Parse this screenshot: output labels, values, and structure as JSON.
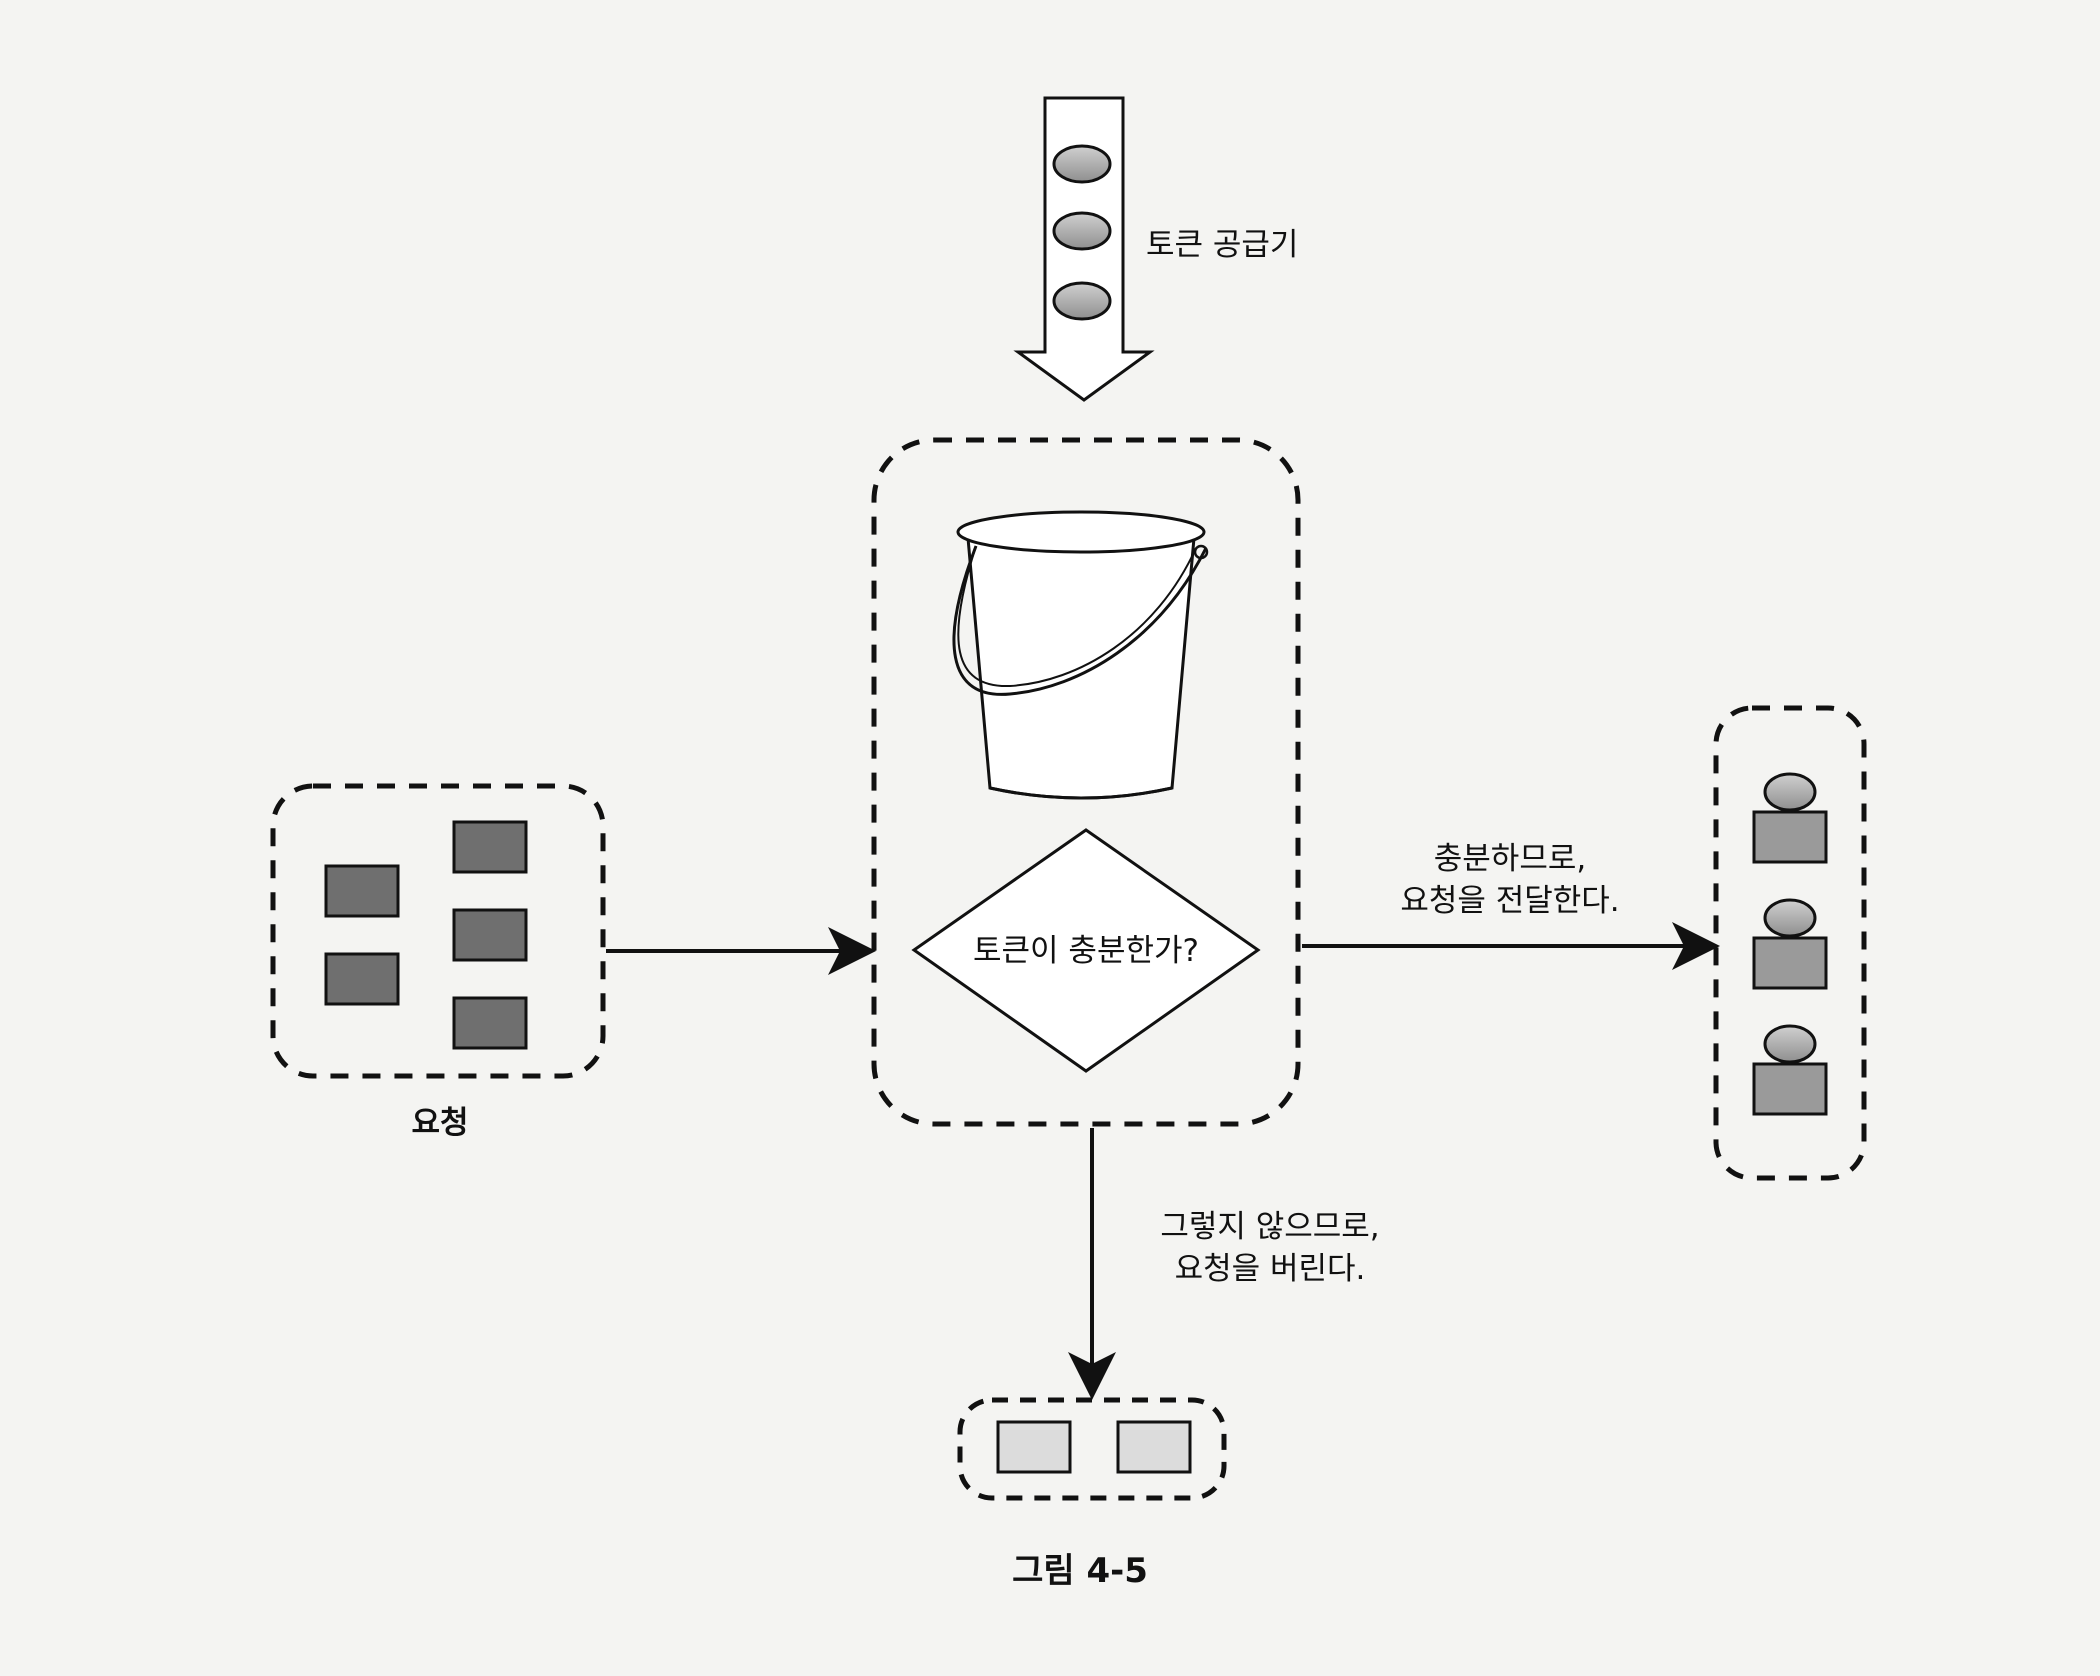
{
  "diagram": {
    "supplier_label": "토큰 공급기",
    "condition_label": "토큰이 충분한가?",
    "requests_label": "요청",
    "pass_label_line1": "충분하므로,",
    "pass_label_line2": "요청을 전달한다.",
    "drop_label_line1": "그렇지 않으므로,",
    "drop_label_line2": "요청을 버린다.",
    "caption": "그림 4-5"
  },
  "colors": {
    "request_fill": "#6f6f6f",
    "passed_fill": "#9a9a9a",
    "dropped_fill": "#dcdcdc",
    "token_fill": "#b0b0b0",
    "line": "#111111"
  }
}
